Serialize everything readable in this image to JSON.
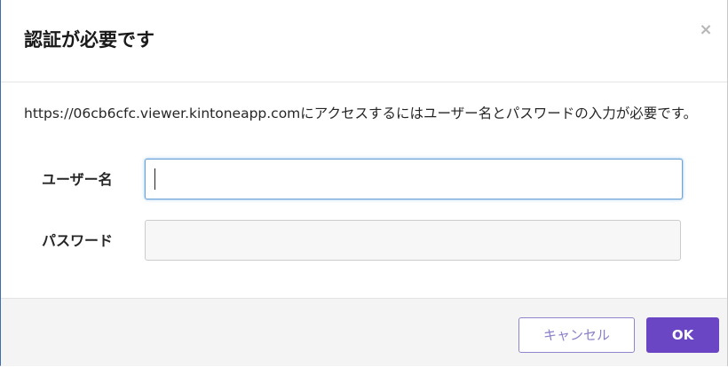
{
  "dialog": {
    "title": "認証が必要です",
    "close_icon": "×",
    "message": "https://06cb6cfc.viewer.kintoneapp.comにアクセスするにはユーザー名とパスワードの入力が必要です。",
    "username": {
      "label": "ユーザー名",
      "value": ""
    },
    "password": {
      "label": "パスワード",
      "value": ""
    },
    "buttons": {
      "cancel_label": "キャンセル",
      "ok_label": "OK"
    },
    "colors": {
      "primary": "#6a46c4",
      "cancel_border": "#8f85cf",
      "focus_border": "#6ea5d8"
    }
  }
}
